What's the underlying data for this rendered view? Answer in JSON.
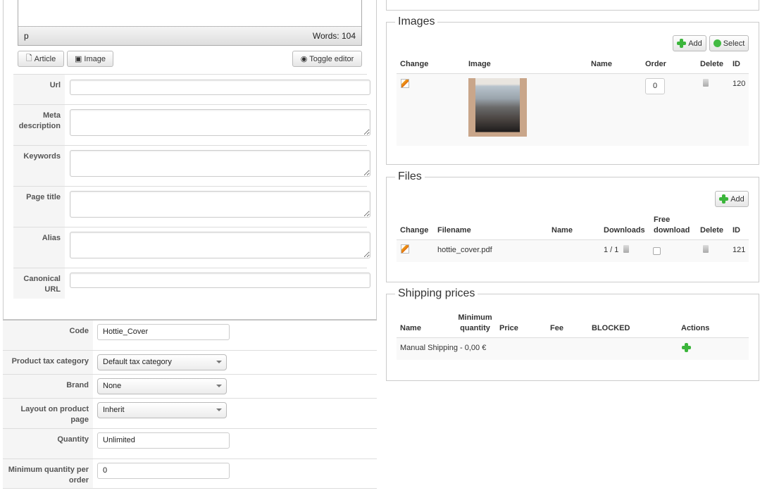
{
  "editor": {
    "path": "p",
    "word_count": "Words: 104"
  },
  "editor_buttons": {
    "article": "Article",
    "image": "Image",
    "toggle": "Toggle editor"
  },
  "seo_fields": [
    {
      "label": "Url",
      "value": ""
    },
    {
      "label": "Meta description",
      "value": ""
    },
    {
      "label": "Keywords",
      "value": ""
    },
    {
      "label": "Page title",
      "value": ""
    },
    {
      "label": "Alias",
      "value": ""
    },
    {
      "label": "Canonical URL",
      "value": ""
    }
  ],
  "product_fields": {
    "code": {
      "label": "Code",
      "value": "Hottie_Cover"
    },
    "tax": {
      "label": "Product tax category",
      "value": "Default tax category"
    },
    "brand": {
      "label": "Brand",
      "value": "None"
    },
    "layout": {
      "label": "Layout on product page",
      "value": "Inherit"
    },
    "quantity": {
      "label": "Quantity",
      "value": "Unlimited"
    },
    "min_qty": {
      "label": "Minimum quantity per order",
      "value": "0"
    }
  },
  "images": {
    "title": "Images",
    "add": "Add",
    "select": "Select",
    "headers": {
      "change": "Change",
      "image": "Image",
      "name": "Name",
      "order": "Order",
      "delete": "Delete",
      "id": "ID"
    },
    "rows": [
      {
        "name": "",
        "order": "0",
        "id": "120"
      }
    ]
  },
  "files": {
    "title": "Files",
    "add": "Add",
    "headers": {
      "change": "Change",
      "filename": "Filename",
      "name": "Name",
      "downloads": "Downloads",
      "free": "Free download",
      "delete": "Delete",
      "id": "ID"
    },
    "rows": [
      {
        "filename": "hottie_cover.pdf",
        "name": "",
        "downloads": "1 / 1",
        "id": "121"
      }
    ]
  },
  "shipping": {
    "title": "Shipping prices",
    "headers": {
      "name": "Name",
      "min_qty": "Minimum quantity",
      "price": "Price",
      "fee": "Fee",
      "blocked": "BLOCKED",
      "actions": "Actions"
    },
    "rows": [
      {
        "name": "Manual Shipping - 0,00 €"
      }
    ]
  }
}
